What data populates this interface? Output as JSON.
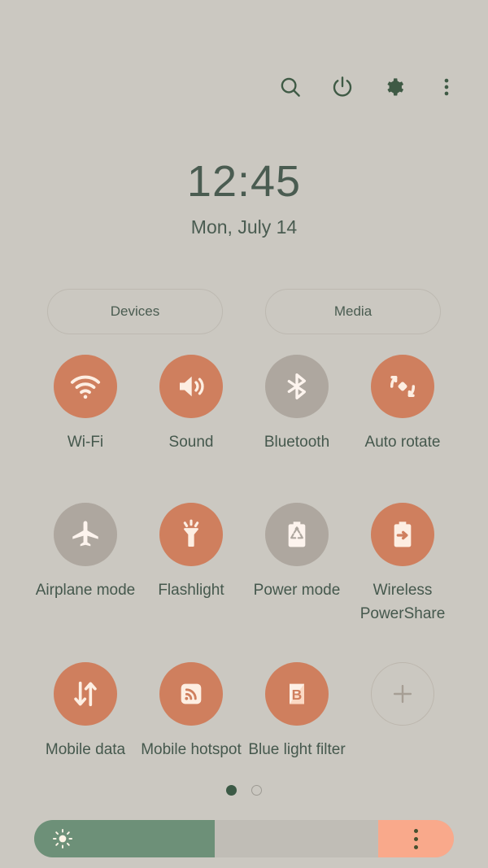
{
  "statusbar": {
    "background_color": "#cbc8c1"
  },
  "topbar": {
    "icons": [
      {
        "name": "search-icon",
        "label": "Search"
      },
      {
        "name": "power-icon",
        "label": "Power"
      },
      {
        "name": "gear-icon",
        "label": "Settings"
      },
      {
        "name": "more-vertical-icon",
        "label": "More options"
      }
    ],
    "icon_color": "#3f5a45"
  },
  "clock": {
    "time": "12:45",
    "date": "Mon, July 14",
    "color": "#4a5c51"
  },
  "quick_buttons": [
    {
      "label": "Devices"
    },
    {
      "label": "Media"
    }
  ],
  "toggles": [
    {
      "label": "Wi-Fi",
      "icon": "wifi-icon",
      "state": "on"
    },
    {
      "label": "Sound",
      "icon": "sound-icon",
      "state": "on"
    },
    {
      "label": "Bluetooth",
      "icon": "bluetooth-icon",
      "state": "off"
    },
    {
      "label": "Auto rotate",
      "icon": "auto-rotate-icon",
      "state": "on"
    },
    {
      "label": "Airplane mode",
      "icon": "airplane-icon",
      "state": "off"
    },
    {
      "label": "Flashlight",
      "icon": "flashlight-icon",
      "state": "on"
    },
    {
      "label": "Power mode",
      "icon": "power-mode-icon",
      "state": "off"
    },
    {
      "label": "Wireless PowerShare",
      "icon": "power-share-icon",
      "state": "on"
    },
    {
      "label": "Mobile data",
      "icon": "mobile-data-icon",
      "state": "on"
    },
    {
      "label": "Mobile hotspot",
      "icon": "mobile-hotspot-icon",
      "state": "on"
    },
    {
      "label": "Blue light filter",
      "icon": "blue-light-icon",
      "state": "on"
    },
    {
      "label": "",
      "icon": "add-icon",
      "state": "add"
    }
  ],
  "colors": {
    "active_toggle": "#cf7f5e",
    "inactive_toggle": "#aea79f",
    "label_text": "#45584d",
    "slider_fill": "#6d9078",
    "slider_track": "#c0bdb6",
    "slider_end": "#f9a98b"
  },
  "pagination": {
    "pages": 2,
    "active_index": 0
  },
  "brightness": {
    "value_percent": 43,
    "icon": "sun-icon",
    "menu_icon": "more-vertical-icon"
  }
}
